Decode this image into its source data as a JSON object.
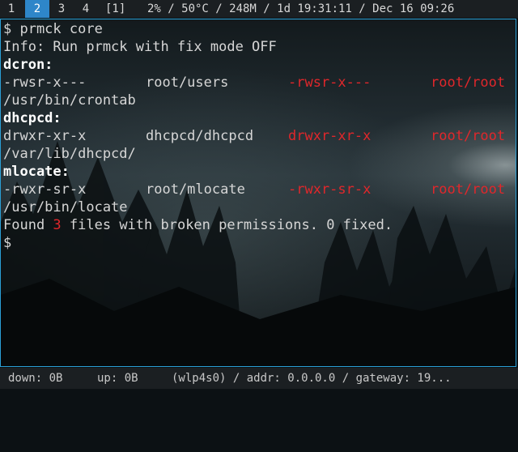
{
  "topbar": {
    "workspaces": [
      "1",
      "2",
      "3",
      "4",
      "[1]"
    ],
    "active_workspace": "2",
    "status": "2% / 50°C / 248M / 1d 19:31:11 / Dec 16 09:26"
  },
  "terminal": {
    "command_line": "$ prmck core",
    "info": "Info: Run prmck with fix mode OFF",
    "packages": [
      {
        "name": "dcron:",
        "perm": "-rwsr-x---",
        "owner": "root/users",
        "expected_perm": "-rwsr-x---",
        "expected_owner": "root/root",
        "path": "/usr/bin/crontab"
      },
      {
        "name": "dhcpcd:",
        "perm": "drwxr-xr-x",
        "owner": "dhcpcd/dhcpcd",
        "expected_perm": "drwxr-xr-x",
        "expected_owner": "root/root",
        "path": "/var/lib/dhcpcd/"
      },
      {
        "name": "mlocate:",
        "perm": "-rwxr-sr-x",
        "owner": "root/mlocate",
        "expected_perm": "-rwxr-sr-x",
        "expected_owner": "root/root",
        "path": "/usr/bin/locate"
      }
    ],
    "summary_prefix": "Found ",
    "summary_count": "3",
    "summary_suffix": " files with broken permissions. 0 fixed.",
    "prompt": "$"
  },
  "bottombar": {
    "down": "down: 0B",
    "up": "up: 0B",
    "net": "(wlp4s0) / addr: 0.0.0.0 / gateway: 19..."
  },
  "colors": {
    "accent": "#2e86c9",
    "border": "#2a9fd6",
    "error": "#e0272b",
    "text": "#d6d6d6"
  }
}
